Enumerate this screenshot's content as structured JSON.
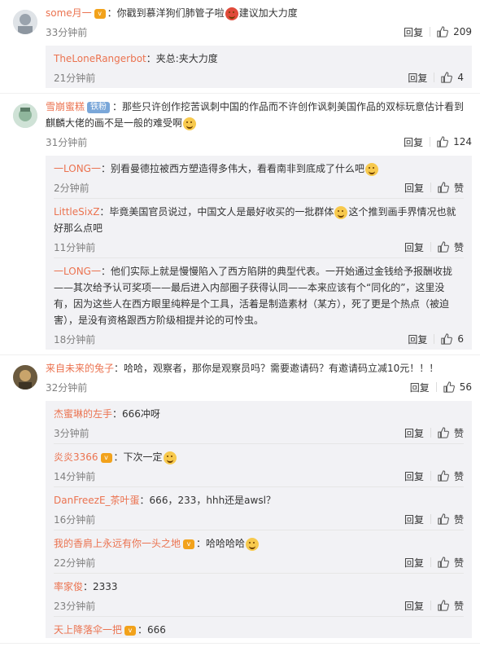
{
  "labels": {
    "reply": "回复",
    "like": "赞"
  },
  "comments": [
    {
      "user": "some月一",
      "text_a": "：你戳到慕洋狗们肺管子啦",
      "text_b": "建议加大力度",
      "time": "33分钟前",
      "likes": "209",
      "replies": [
        {
          "user": "TheLoneRangerbot",
          "text": "：夹总:夹大力度",
          "time": "21分钟前",
          "likes": "4"
        }
      ]
    },
    {
      "user": "雪崩蜜糕",
      "badge": "铁粉",
      "text": "：那些只许创作挖苦讽刺中国的作品而不许创作讽刺美国作品的双标玩意估计看到麒麟大佬的画不是一般的难受啊",
      "time": "31分钟前",
      "likes": "124",
      "replies": [
        {
          "user": "一LONG一",
          "text": "：别看曼德拉被西方塑造得多伟大，看看南非到底成了什么吧",
          "time": "2分钟前",
          "likes": "赞"
        },
        {
          "user": "LittleSixZ",
          "text": "：毕竟美国官员说过，中国文人是最好收买的一批群体",
          "text_b": "这个推到画手界情况也就好那么点吧",
          "time": "11分钟前",
          "likes": "赞"
        },
        {
          "user": "一LONG一",
          "text": "：他们实际上就是慢慢陷入了西方陷阱的典型代表。一开始通过金钱给予报酬收拢——其次给予认可奖项——最后进入内部圈子获得认同——本来应该有个“同化的”，这里没有，因为这些人在西方眼里纯粹是个工具，活着是制造素材（某方），死了更是个热点（被迫害），是没有资格跟西方阶级相提并论的可怜虫。",
          "time": "18分钟前",
          "likes": "6"
        }
      ]
    },
    {
      "user": "来自未来的兔子",
      "text": "：哈哈，观察者，那你是观察员吗？需要邀请码？有邀请码立减10元！！！",
      "time": "32分钟前",
      "likes": "56",
      "replies": [
        {
          "user": "杰蜜琳的左手",
          "text": "：666冲呀",
          "time": "3分钟前",
          "likes": "赞"
        },
        {
          "user": "炎炎3366",
          "text": "：下次一定",
          "time": "14分钟前",
          "likes": "赞"
        },
        {
          "user": "DanFreezE_茶叶蛋",
          "text": "：666，233，hhh还是awsl？",
          "time": "16分钟前",
          "likes": "赞"
        },
        {
          "user": "我的香肩上永远有你一头之地",
          "text": "：哈哈哈哈",
          "time": "22分钟前",
          "likes": "赞"
        },
        {
          "user": "率家俊",
          "text": "：2333",
          "time": "23分钟前",
          "likes": "赞"
        },
        {
          "user": "天上降落伞一把",
          "text": "：666",
          "time": "",
          "likes": ""
        }
      ]
    }
  ]
}
